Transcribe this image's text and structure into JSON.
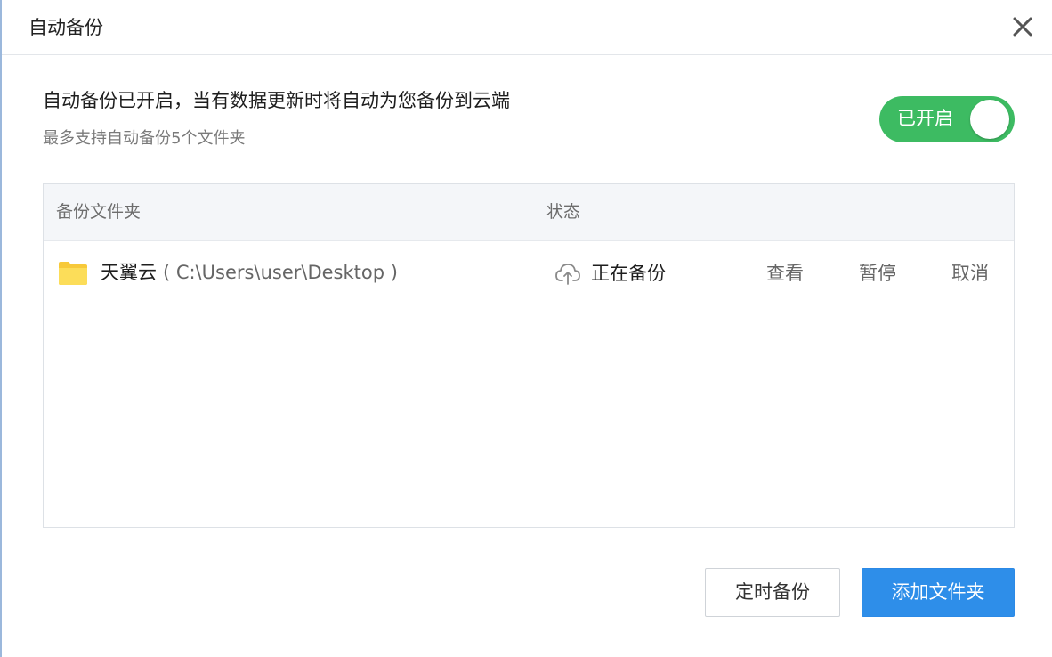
{
  "dialog": {
    "title": "自动备份",
    "close_icon": "close-icon"
  },
  "info": {
    "headline": "自动备份已开启，当有数据更新时将自动为您备份到云端",
    "subline": "最多支持自动备份5个文件夹"
  },
  "toggle": {
    "label": "已开启",
    "state": "on",
    "color": "#3dbb62"
  },
  "table": {
    "columns": [
      "备份文件夹",
      "状态"
    ],
    "rows": [
      {
        "icon": "folder-icon",
        "name": "天翼云",
        "path": "( C:\\Users\\user\\Desktop )",
        "status_icon": "cloud-upload-icon",
        "status": "正在备份",
        "actions": [
          "查看",
          "暂停",
          "取消"
        ]
      }
    ]
  },
  "footer": {
    "schedule_label": "定时备份",
    "add_label": "添加文件夹",
    "primary_color": "#2e8ee9"
  }
}
